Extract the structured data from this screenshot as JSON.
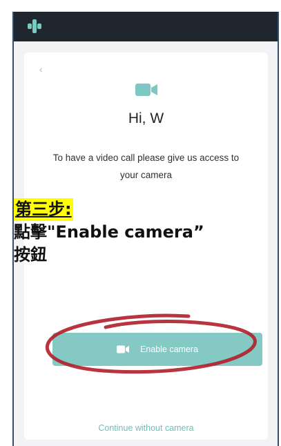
{
  "app": {
    "logo_icon": "teal-plus-logo-icon",
    "accent_color": "#84c9c4"
  },
  "card": {
    "back_icon": "chevron-left-icon",
    "camera_icon": "video-camera-icon",
    "greeting": "Hi, W",
    "description": "To have a video call please give us access to your camera",
    "enable_button_label": "Enable camera",
    "continue_link": "Continue without camera"
  },
  "annotation": {
    "step_title": "第三步:",
    "instruction_line1": "點擊\"Enable camera”",
    "instruction_line2": "按鈕",
    "highlight_color": "#ffff00",
    "circle_color": "#b01e2a"
  }
}
